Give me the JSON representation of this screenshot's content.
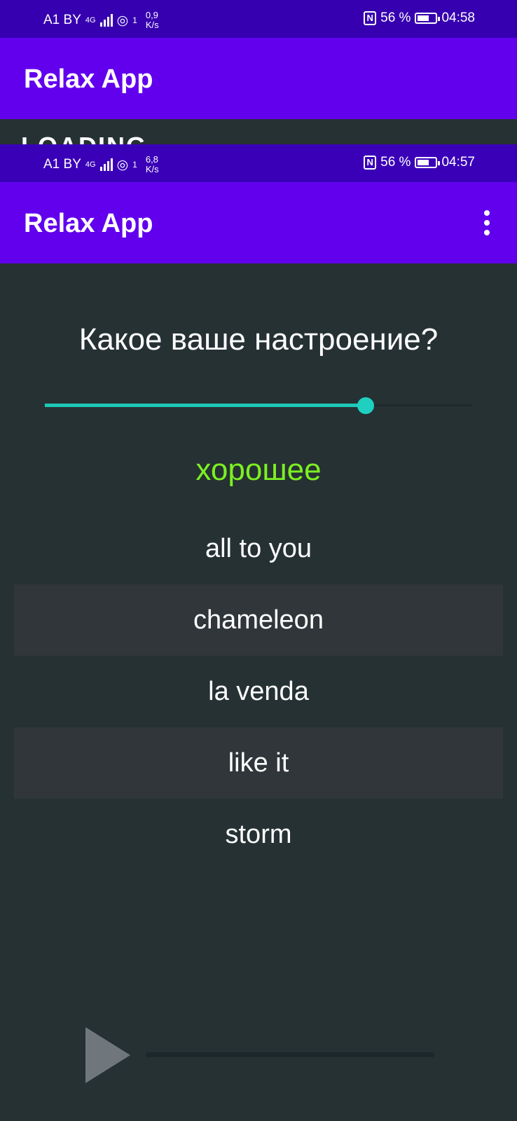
{
  "status_top": {
    "carrier": "A1 BY",
    "network": "4G",
    "sim": "1",
    "speed_value": "0,9",
    "speed_unit": "K/s",
    "battery": "56 %",
    "time": "04:58"
  },
  "app_top": {
    "title": "Relax App"
  },
  "ghost": {
    "text": "LOADING"
  },
  "status_second": {
    "carrier": "A1 BY",
    "network": "4G",
    "sim": "1",
    "speed_value": "6,8",
    "speed_unit": "K/s",
    "battery": "56 %",
    "time": "04:57"
  },
  "app_main": {
    "title": "Relax App",
    "menu_icon": "more-vert-icon"
  },
  "mood": {
    "question": "Какое ваше настроение?",
    "slider_fraction": 0.75,
    "value_label": "хорошее",
    "value_color": "#7cf021"
  },
  "tracks": [
    {
      "title": "all to you"
    },
    {
      "title": "chameleon"
    },
    {
      "title": "la venda"
    },
    {
      "title": "like it"
    },
    {
      "title": "storm"
    }
  ],
  "player": {
    "play_icon": "play-icon",
    "progress_fraction": 0.0
  },
  "colors": {
    "accent": "#6200ee",
    "status_bar": "#3700b3",
    "teal": "#1fc8b8",
    "background": "#263134"
  }
}
